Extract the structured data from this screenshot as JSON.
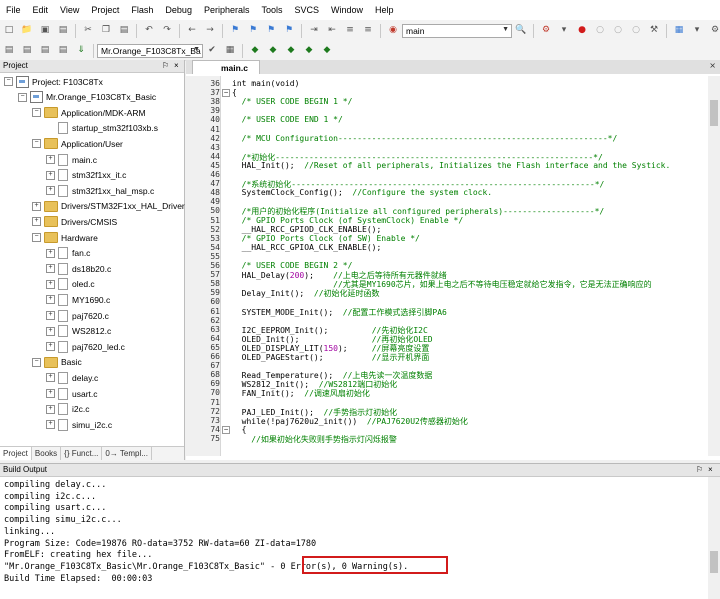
{
  "menu": [
    "File",
    "Edit",
    "View",
    "Project",
    "Flash",
    "Debug",
    "Peripherals",
    "Tools",
    "SVCS",
    "Window",
    "Help"
  ],
  "toolbar": {
    "find_value": "main",
    "target_value": "Mr.Orange_F103C8Tx_Ba"
  },
  "project": {
    "title": "Project",
    "pin": "⚐",
    "close": "×",
    "tree": [
      {
        "label": "Project: F103C8Tx",
        "kind": "root",
        "level": 0,
        "exp": "−"
      },
      {
        "label": "Mr.Orange_F103C8Tx_Basic",
        "kind": "target",
        "level": 1,
        "exp": "−"
      },
      {
        "label": "Application/MDK-ARM",
        "kind": "folder",
        "level": 2,
        "exp": "−"
      },
      {
        "label": "startup_stm32f103xb.s",
        "kind": "file",
        "level": 3,
        "exp": ""
      },
      {
        "label": "Application/User",
        "kind": "folder",
        "level": 2,
        "exp": "−"
      },
      {
        "label": "main.c",
        "kind": "file",
        "level": 3,
        "exp": "+"
      },
      {
        "label": "stm32f1xx_it.c",
        "kind": "file",
        "level": 3,
        "exp": "+"
      },
      {
        "label": "stm32f1xx_hal_msp.c",
        "kind": "file",
        "level": 3,
        "exp": "+"
      },
      {
        "label": "Drivers/STM32F1xx_HAL_Driver",
        "kind": "folder",
        "level": 2,
        "exp": "+"
      },
      {
        "label": "Drivers/CMSIS",
        "kind": "folder",
        "level": 2,
        "exp": "+"
      },
      {
        "label": "Hardware",
        "kind": "folder",
        "level": 2,
        "exp": "−"
      },
      {
        "label": "fan.c",
        "kind": "file",
        "level": 3,
        "exp": "+"
      },
      {
        "label": "ds18b20.c",
        "kind": "file",
        "level": 3,
        "exp": "+"
      },
      {
        "label": "oled.c",
        "kind": "file",
        "level": 3,
        "exp": "+"
      },
      {
        "label": "MY1690.c",
        "kind": "file",
        "level": 3,
        "exp": "+"
      },
      {
        "label": "paj7620.c",
        "kind": "file",
        "level": 3,
        "exp": "+"
      },
      {
        "label": "WS2812.c",
        "kind": "file",
        "level": 3,
        "exp": "+"
      },
      {
        "label": "paj7620_led.c",
        "kind": "file",
        "level": 3,
        "exp": "+"
      },
      {
        "label": "Basic",
        "kind": "folder",
        "level": 2,
        "exp": "−"
      },
      {
        "label": "delay.c",
        "kind": "file",
        "level": 3,
        "exp": "+"
      },
      {
        "label": "usart.c",
        "kind": "file",
        "level": 3,
        "exp": "+"
      },
      {
        "label": "i2c.c",
        "kind": "file",
        "level": 3,
        "exp": "+"
      },
      {
        "label": "simu_i2c.c",
        "kind": "file",
        "level": 3,
        "exp": "+"
      }
    ],
    "tabs": [
      "Project",
      "Books",
      "{} Funct...",
      "0→ Templ..."
    ]
  },
  "editor": {
    "tab_label": "main.c",
    "lines": [
      {
        "n": "36",
        "t": "int main(void)",
        "c": "tx"
      },
      {
        "n": "37",
        "t": "{",
        "c": "tx"
      },
      {
        "n": "38",
        "t": "  /* USER CODE BEGIN 1 */",
        "c": "cm"
      },
      {
        "n": "39",
        "t": "",
        "c": "tx"
      },
      {
        "n": "40",
        "t": "  /* USER CODE END 1 */",
        "c": "cm"
      },
      {
        "n": "41",
        "t": "",
        "c": "tx"
      },
      {
        "n": "42",
        "t": "  /* MCU Configuration--------------------------------------------------------*/",
        "c": "cm"
      },
      {
        "n": "43",
        "t": "",
        "c": "tx"
      },
      {
        "n": "44",
        "t": "  /*初始化------------------------------------------------------------------*/",
        "c": "cm"
      },
      {
        "n": "45",
        "t": "  HAL_Init();  //Reset of all peripherals, Initializes the Flash interface and the Systick.",
        "c": "mix",
        "code": "  HAL_Init();  ",
        "comment": "//Reset of all peripherals, Initializes the Flash interface and the Systick."
      },
      {
        "n": "46",
        "t": "",
        "c": "tx"
      },
      {
        "n": "47",
        "t": "  /*系统初始化---------------------------------------------------------------*/",
        "c": "cm"
      },
      {
        "n": "48",
        "t": "  SystemClock_Config();  //Configure the system clock.",
        "c": "mix",
        "code": "  SystemClock_Config();  ",
        "comment": "//Configure the system clock."
      },
      {
        "n": "49",
        "t": "",
        "c": "tx"
      },
      {
        "n": "50",
        "t": "  /*用户的初始化程序(Initialize all configured peripherals)-------------------*/",
        "c": "cm"
      },
      {
        "n": "51",
        "t": "  /* GPIO Ports Clock (of SystemClock) Enable */",
        "c": "cm"
      },
      {
        "n": "52",
        "t": "  __HAL_RCC_GPIOD_CLK_ENABLE();",
        "c": "tx"
      },
      {
        "n": "53",
        "t": "  /* GPIO Ports Clock (of SW) Enable */",
        "c": "cm"
      },
      {
        "n": "54",
        "t": "  __HAL_RCC_GPIOA_CLK_ENABLE();",
        "c": "tx"
      },
      {
        "n": "55",
        "t": "",
        "c": "tx"
      },
      {
        "n": "56",
        "t": "  /* USER CODE BEGIN 2 */",
        "c": "cm"
      },
      {
        "n": "57",
        "t": "  HAL_Delay(200);    //上电之后等待所有元器件就绪",
        "c": "mix3",
        "code": "  HAL_Delay(",
        "num": "200",
        "rest": ");    ",
        "comment": "//上电之后等待所有元器件就绪"
      },
      {
        "n": "58",
        "t": "                     //尤其是MY1690芯片，如果上电之后不等待电压稳定就给它发指令，它是无法正确响应的",
        "c": "cm"
      },
      {
        "n": "59",
        "t": "  Delay_Init();  //初始化延时函数",
        "c": "mix",
        "code": "  Delay_Init();  ",
        "comment": "//初始化延时函数"
      },
      {
        "n": "60",
        "t": "",
        "c": "tx"
      },
      {
        "n": "61",
        "t": "  SYSTEM_MODE_Init();  //配置工作模式选择引脚PA6",
        "c": "mix",
        "code": "  SYSTEM_MODE_Init();  ",
        "comment": "//配置工作模式选择引脚PA6"
      },
      {
        "n": "62",
        "t": "",
        "c": "tx"
      },
      {
        "n": "63",
        "t": "  I2C_EEPROM_Init();         //先初始化I2C",
        "c": "mix",
        "code": "  I2C_EEPROM_Init();         ",
        "comment": "//先初始化I2C"
      },
      {
        "n": "64",
        "t": "  OLED_Init();               //再初始化OLED",
        "c": "mix",
        "code": "  OLED_Init();               ",
        "comment": "//再初始化OLED"
      },
      {
        "n": "65",
        "t": "  OLED_DISPLAY_LIT(150);     //屏幕亮度设置",
        "c": "mix3",
        "code": "  OLED_DISPLAY_LIT(",
        "num": "150",
        "rest": ");     ",
        "comment": "//屏幕亮度设置"
      },
      {
        "n": "66",
        "t": "  OLED_PAGEStart();          //显示开机界面",
        "c": "mix",
        "code": "  OLED_PAGEStart();          ",
        "comment": "//显示开机界面"
      },
      {
        "n": "67",
        "t": "",
        "c": "tx"
      },
      {
        "n": "68",
        "t": "  Read_Temperature();  //上电先读一次温度数据",
        "c": "mix",
        "code": "  Read_Temperature();  ",
        "comment": "//上电先读一次温度数据"
      },
      {
        "n": "69",
        "t": "  WS2812_Init();  //WS2812端口初始化",
        "c": "mix",
        "code": "  WS2812_Init();  ",
        "comment": "//WS2812端口初始化"
      },
      {
        "n": "70",
        "t": "  FAN_Init();  //调速风扇初始化",
        "c": "mix",
        "code": "  FAN_Init();  ",
        "comment": "//调速风扇初始化"
      },
      {
        "n": "71",
        "t": "",
        "c": "tx"
      },
      {
        "n": "72",
        "t": "  PAJ_LED_Init();  //手势指示灯初始化",
        "c": "mix",
        "code": "  PAJ_LED_Init();  ",
        "comment": "//手势指示灯初始化"
      },
      {
        "n": "73",
        "t": "  while(!paj7620u2_init())  //PAJ7620U2传感器初始化",
        "c": "mix",
        "code": "  while(!paj7620u2_init())  ",
        "comment": "//PAJ7620U2传感器初始化"
      },
      {
        "n": "74",
        "t": "  {",
        "c": "tx"
      },
      {
        "n": "75",
        "t": "    //如果初始化失败则手势指示灯闪烁报警",
        "c": "cm"
      }
    ]
  },
  "build": {
    "title": "Build Output",
    "lines": [
      "compiling delay.c...",
      "compiling i2c.c...",
      "compiling usart.c...",
      "compiling simu_i2c.c...",
      "linking...",
      "Program Size: Code=19876 RO-data=3752 RW-data=60 ZI-data=1780",
      "FromELF: creating hex file...",
      "\"Mr.Orange_F103C8Tx_Basic\\Mr.Orange_F103C8Tx_Basic\" - 0 Error(s), 0 Warning(s).",
      "Build Time Elapsed:  00:00:03"
    ]
  },
  "colors": {
    "comment": "#008000",
    "number": "#a000a0",
    "highlight": "#d21b1b"
  }
}
